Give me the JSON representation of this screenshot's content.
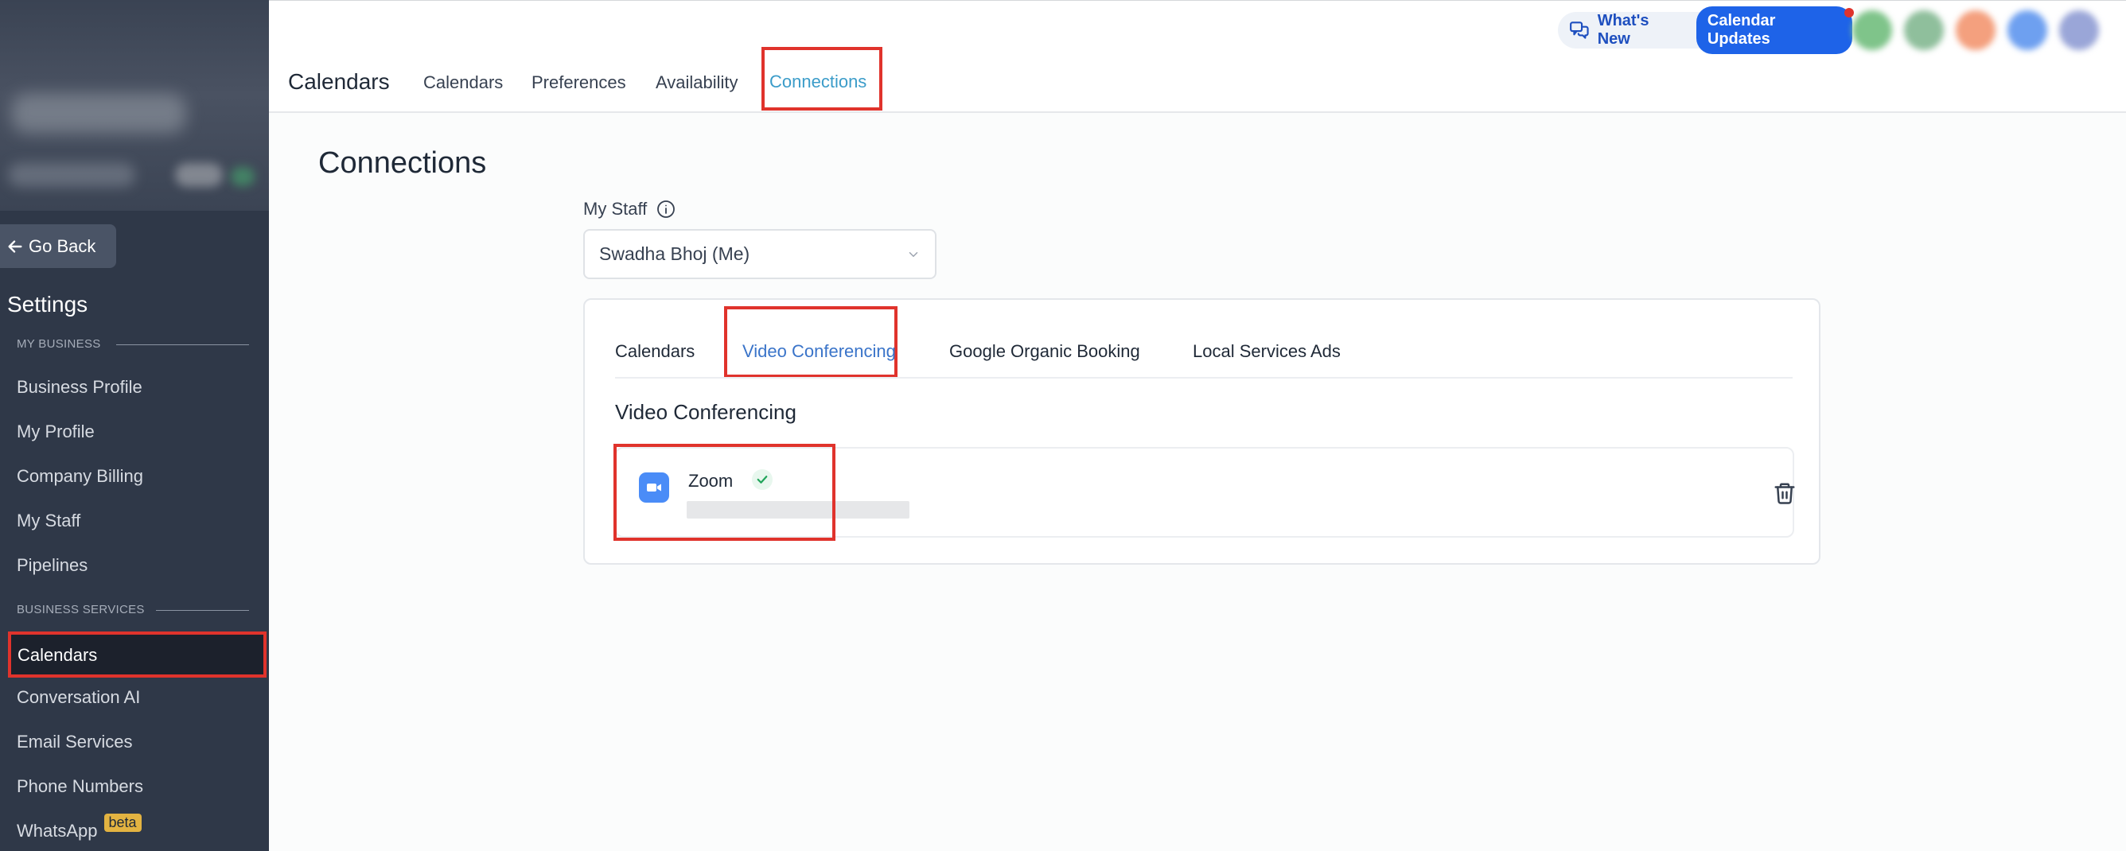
{
  "sidebar": {
    "go_back": "Go Back",
    "settings_title": "Settings",
    "section_my_business": "MY BUSINESS",
    "section_business_services": "BUSINESS SERVICES",
    "items": [
      {
        "label": "Business Profile"
      },
      {
        "label": "My Profile"
      },
      {
        "label": "Company Billing"
      },
      {
        "label": "My Staff"
      },
      {
        "label": "Pipelines"
      },
      {
        "label": "Calendars"
      },
      {
        "label": "Conversation AI"
      },
      {
        "label": "Email Services"
      },
      {
        "label": "Phone Numbers"
      },
      {
        "label": "WhatsApp",
        "badge": "beta"
      }
    ]
  },
  "header": {
    "title": "Calendars",
    "tabs": [
      {
        "label": "Calendars"
      },
      {
        "label": "Preferences"
      },
      {
        "label": "Availability"
      },
      {
        "label": "Connections"
      }
    ],
    "whats_new": "What's New",
    "calendar_updates": "Calendar Updates"
  },
  "colors": {
    "sidebar_bg": "#2f3848",
    "highlight": "#e0332c",
    "accent_blue": "#1e63e8",
    "active_tab": "#3b9cc9"
  },
  "main": {
    "title": "Connections",
    "staff_label": "My Staff",
    "staff_value": "Swadha Bhoj (Me)",
    "tabs": [
      {
        "label": "Calendars"
      },
      {
        "label": "Video Conferencing"
      },
      {
        "label": "Google Organic Booking"
      },
      {
        "label": "Local Services Ads"
      }
    ],
    "section_title": "Video Conferencing",
    "connection": {
      "name": "Zoom",
      "icon": "zoom-video-icon",
      "status": "connected"
    }
  }
}
